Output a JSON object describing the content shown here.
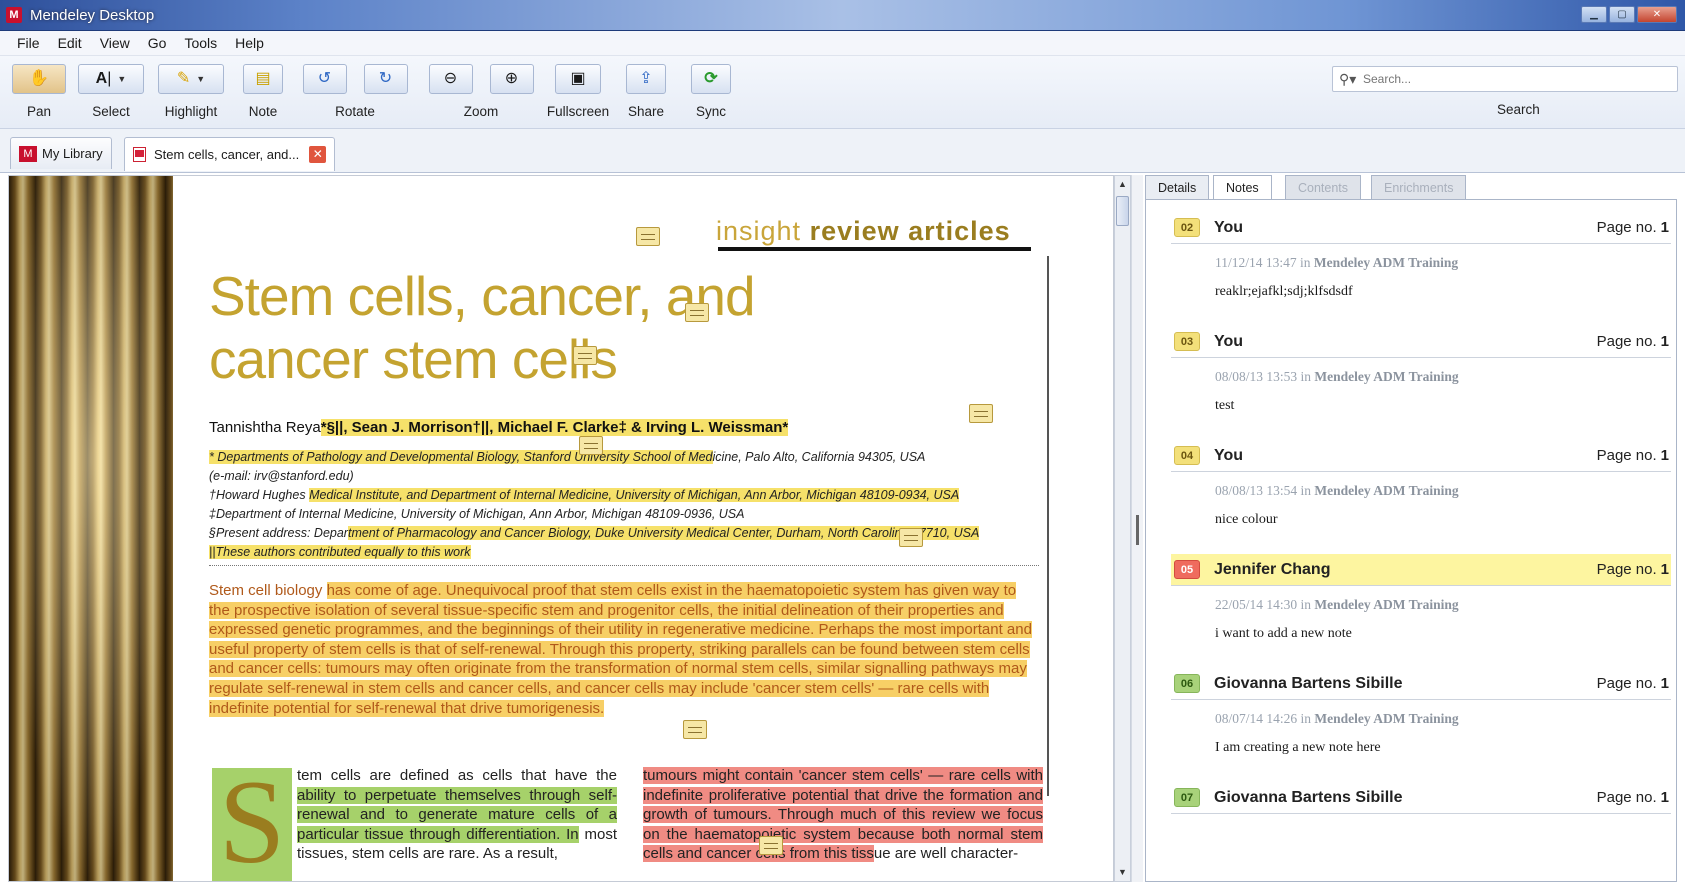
{
  "window": {
    "title": "Mendeley Desktop",
    "app_icon": "M"
  },
  "menu": [
    "File",
    "Edit",
    "View",
    "Go",
    "Tools",
    "Help"
  ],
  "toolbar": {
    "pan": "Pan",
    "select": "Select",
    "highlight": "Highlight",
    "note": "Note",
    "rotate": "Rotate",
    "zoom": "Zoom",
    "fullscreen": "Fullscreen",
    "share": "Share",
    "sync": "Sync",
    "search_placeholder": "Search...",
    "search_label": "Search"
  },
  "tabs": {
    "library": "My Library",
    "document": "Stem cells, cancer, and..."
  },
  "document": {
    "brand_light": "insight",
    "brand_bold": "review articles",
    "title_line1": "Stem cells, cancer, and",
    "title_line2": "cancer stem cells",
    "author_first": "Tannishtha Reya",
    "author_rest": "*§||, Sean J. Morrison†||, Michael F. Clarke‡ & Irving L. Weissman*",
    "affil1_hl": "* Departments of Pathology and Developmental Biology, Stanford University School of Med",
    "affil1_rest": "icine, Palo Alto, California 94305, USA",
    "affil1_email": "(e-mail: irv@stanford.edu)",
    "affil2_a": "†Howard Hughes ",
    "affil2_hl": "Medical Institute, and Department of Internal Medicine, University of Michigan, Ann Arbor, Michigan 48109-0934, USA",
    "affil3": "‡Department of Internal Medicine, University of Michigan, Ann Arbor, Michigan 48109-0936, USA",
    "affil4_a": "§Present address: Depar",
    "affil4_hl": "tment of Pharmacology and Cancer Biology, Duke University Medical Center, Durham, North Carolina 27710, USA",
    "affil5": "||These authors contributed equally to this work",
    "abstract_plain": "Stem cell biology ",
    "abstract_hl": "has come of age. Unequivocal proof that stem cells exist in the haematopoietic system has given way to the prospective isolation of several tissue-specific stem and progenitor cells, the initial delineation of their properties and expressed genetic programmes, and the beginnings of their utility in regenerative medicine. Perhaps the most important and useful property of stem cells is that of self-renewal. Through this property, striking parallels can be found between stem cells and cancer cells: tumours may often originate from the transformation of normal stem cells, similar signalling pathways may regulate self-renewal in stem cells and cancer cells, and cancer cells may include 'cancer stem cells' — rare cells with indefinite potential for self-renewal that drive tumorigenesis.",
    "dropcap": "S",
    "col_left_a": "tem cells are defined as cells that have the ",
    "col_left_hl": "ability to perpetuate themselves through self-renewal and to generate mature cells of a particular tissue through differentiation. In",
    "col_left_b": " most tissues, stem cells are rare. As a result,",
    "col_right_hl": "tumours might contain 'cancer stem cells' — rare cells with indefinite proliferative potential that drive the formation and growth of tumours. Through much of this review we focus on the haematopoietic system because both normal stem cells and cancer cells from this tiss",
    "col_right_b": "ue are well character-"
  },
  "panel_tabs": [
    "Details",
    "Notes",
    "Contents",
    "Enrichments"
  ],
  "notes": [
    {
      "num": "02",
      "author": "You",
      "page_label": "Page no.",
      "page": "1",
      "when": "11/12/14 13:47",
      "in": "in",
      "group": "Mendeley ADM Training",
      "text": "reaklr;ejafkl;sdj;klfsdsdf",
      "color": "y"
    },
    {
      "num": "03",
      "author": "You",
      "page_label": "Page no.",
      "page": "1",
      "when": "08/08/13 13:53",
      "in": "in",
      "group": "Mendeley ADM Training",
      "text": "test",
      "color": "y"
    },
    {
      "num": "04",
      "author": "You",
      "page_label": "Page no.",
      "page": "1",
      "when": "08/08/13 13:54",
      "in": "in",
      "group": "Mendeley ADM Training",
      "text": "nice colour",
      "color": "y"
    },
    {
      "num": "05",
      "author": "Jennifer Chang",
      "page_label": "Page no.",
      "page": "1",
      "when": "22/05/14 14:30",
      "in": "in",
      "group": "Mendeley ADM Training",
      "text": "i want to add a new note",
      "color": "r"
    },
    {
      "num": "06",
      "author": "Giovanna Bartens Sibille",
      "page_label": "Page no.",
      "page": "1",
      "when": "08/07/14 14:26",
      "in": "in",
      "group": "Mendeley ADM Training",
      "text": "I am creating a new note here",
      "color": "g"
    },
    {
      "num": "07",
      "author": "Giovanna Bartens Sibille",
      "page_label": "Page no.",
      "page": "1",
      "color": "g"
    }
  ]
}
